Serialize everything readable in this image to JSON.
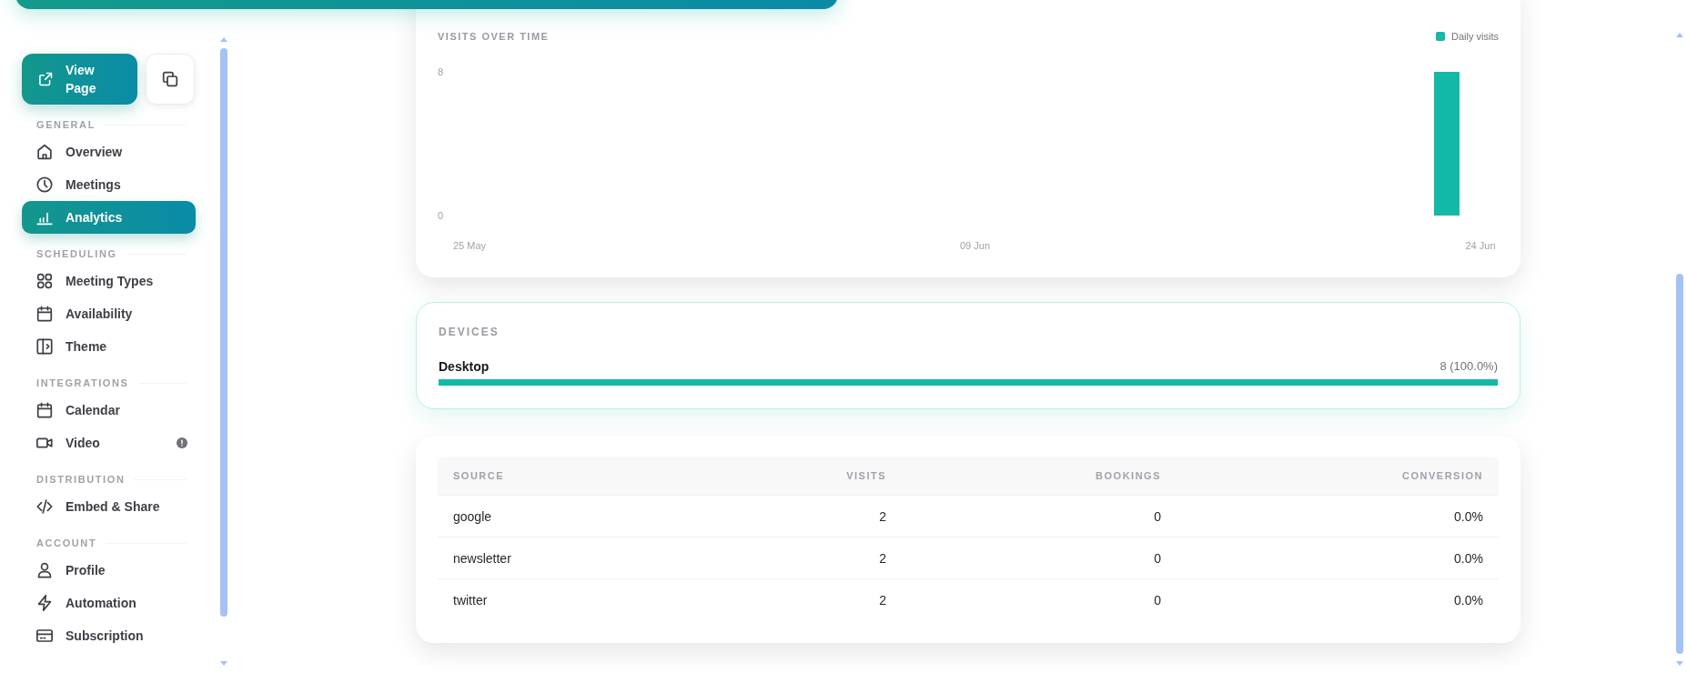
{
  "sidebar": {
    "actions": [
      {
        "kind": "primary",
        "label": "View Page"
      },
      {
        "kind": "icon"
      }
    ],
    "sections": [
      {
        "title": "GENERAL",
        "items": [
          {
            "label": "Overview",
            "selected": false,
            "notice": false
          },
          {
            "label": "Meetings",
            "selected": false,
            "notice": false
          },
          {
            "label": "Analytics",
            "selected": true,
            "notice": false
          }
        ]
      },
      {
        "title": "SCHEDULING",
        "items": [
          {
            "label": "Meeting Types",
            "selected": false,
            "notice": false
          },
          {
            "label": "Availability",
            "selected": false,
            "notice": false
          },
          {
            "label": "Theme",
            "selected": false,
            "notice": false
          }
        ]
      },
      {
        "title": "INTEGRATIONS",
        "items": [
          {
            "label": "Calendar",
            "selected": false,
            "notice": false
          },
          {
            "label": "Video",
            "selected": false,
            "notice": true
          }
        ]
      },
      {
        "title": "DISTRIBUTION",
        "items": [
          {
            "label": "Embed & Share",
            "selected": false,
            "notice": false
          }
        ]
      },
      {
        "title": "ACCOUNT",
        "items": [
          {
            "label": "Profile",
            "selected": false,
            "notice": false
          },
          {
            "label": "Automation",
            "selected": false,
            "notice": false
          },
          {
            "label": "Subscription",
            "selected": false,
            "notice": false
          }
        ]
      }
    ]
  },
  "visits_chart": {
    "chart_data": {
      "type": "bar",
      "title": "VISITS OVER TIME",
      "categories": [
        "25 May",
        null,
        null,
        null,
        null,
        null,
        null,
        null,
        null,
        null,
        null,
        null,
        null,
        null,
        null,
        "09 Jun",
        null,
        null,
        null,
        null,
        null,
        null,
        null,
        null,
        null,
        null,
        null,
        null,
        null,
        null,
        "24 Jun"
      ],
      "series": [
        {
          "name": "Daily visits",
          "color": "#14b8a6",
          "values": [
            0,
            0,
            0,
            0,
            0,
            0,
            0,
            0,
            0,
            0,
            0,
            0,
            0,
            0,
            0,
            0,
            0,
            0,
            0,
            0,
            0,
            0,
            0,
            0,
            0,
            0,
            0,
            0,
            0,
            8,
            0
          ]
        }
      ],
      "ylim": [
        0,
        8
      ],
      "yticks": [
        0,
        8
      ]
    }
  },
  "devices": {
    "title": "DEVICES",
    "items": [
      {
        "name": "Desktop",
        "reading": "8 (100.0%)",
        "level": 1
      }
    ]
  },
  "sources_table": {
    "columns": [
      "SOURCE",
      "VISITS",
      "BOOKINGS",
      "CONVERSION"
    ],
    "rows": [
      [
        "google",
        "2",
        "0",
        "0.0%"
      ],
      [
        "newsletter",
        "2",
        "0",
        "0.0%"
      ],
      [
        "twitter",
        "2",
        "0",
        "0.0%"
      ]
    ]
  }
}
